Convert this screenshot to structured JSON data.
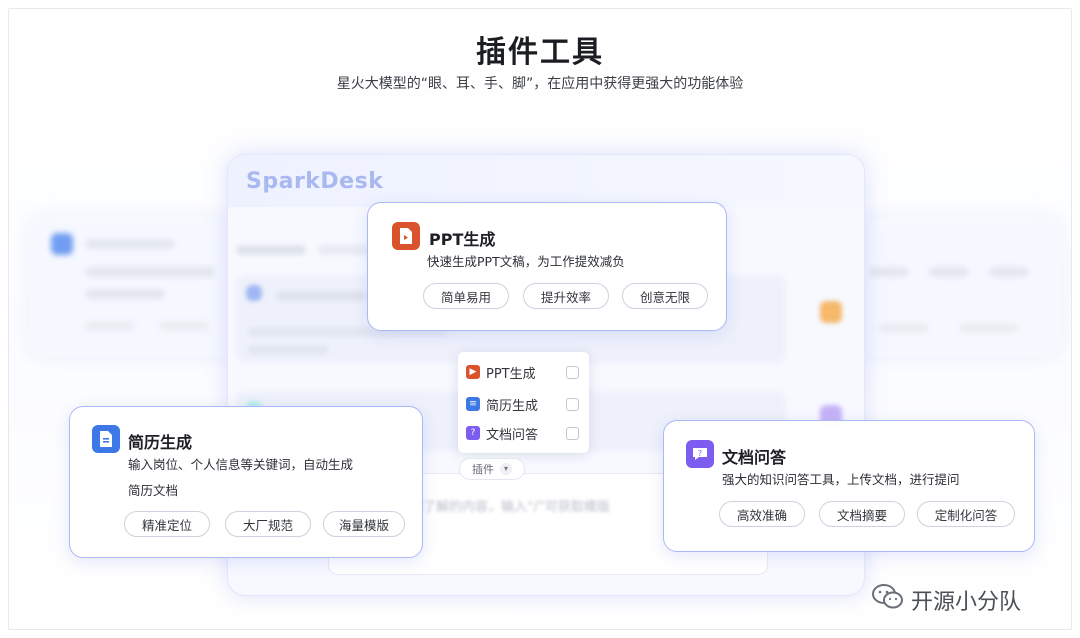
{
  "header": {
    "title": "插件工具",
    "subtitle": "星火大模型的“眼、耳、手、脚”，在应用中获得更强大的功能体验"
  },
  "window": {
    "brand": "SparkDesk",
    "input_placeholder": "在此输入您想了解的内容，输入“/”可获取模版"
  },
  "plugin_menu": {
    "items": [
      {
        "label": "PPT生成",
        "color": "#d9532c",
        "icon": "ppt-icon"
      },
      {
        "label": "简历生成",
        "color": "#3d78e6",
        "icon": "resume-icon"
      },
      {
        "label": "文档问答",
        "color": "#7d5cf0",
        "icon": "doc-qa-icon"
      }
    ],
    "button_label": "插件"
  },
  "cards": {
    "ppt": {
      "title": "PPT生成",
      "desc": "快速生成PPT文稿，为工作提效减负",
      "tags": [
        "简单易用",
        "提升效率",
        "创意无限"
      ],
      "icon_color": "#d9532c"
    },
    "resume": {
      "title": "简历生成",
      "desc_line1": "输入岗位、个人信息等关键词，自动生成",
      "desc_line2": "简历文档",
      "tags": [
        "精准定位",
        "大厂规范",
        "海量模版"
      ],
      "icon_color": "#3d78e6"
    },
    "docqa": {
      "title": "文档问答",
      "desc": "强大的知识问答工具，上传文档，进行提问",
      "tags": [
        "高效准确",
        "文档摘要",
        "定制化问答"
      ],
      "icon_color": "#7d5cf0"
    }
  },
  "watermark": {
    "text": "开源小分队",
    "icon": "wechat-icon"
  }
}
